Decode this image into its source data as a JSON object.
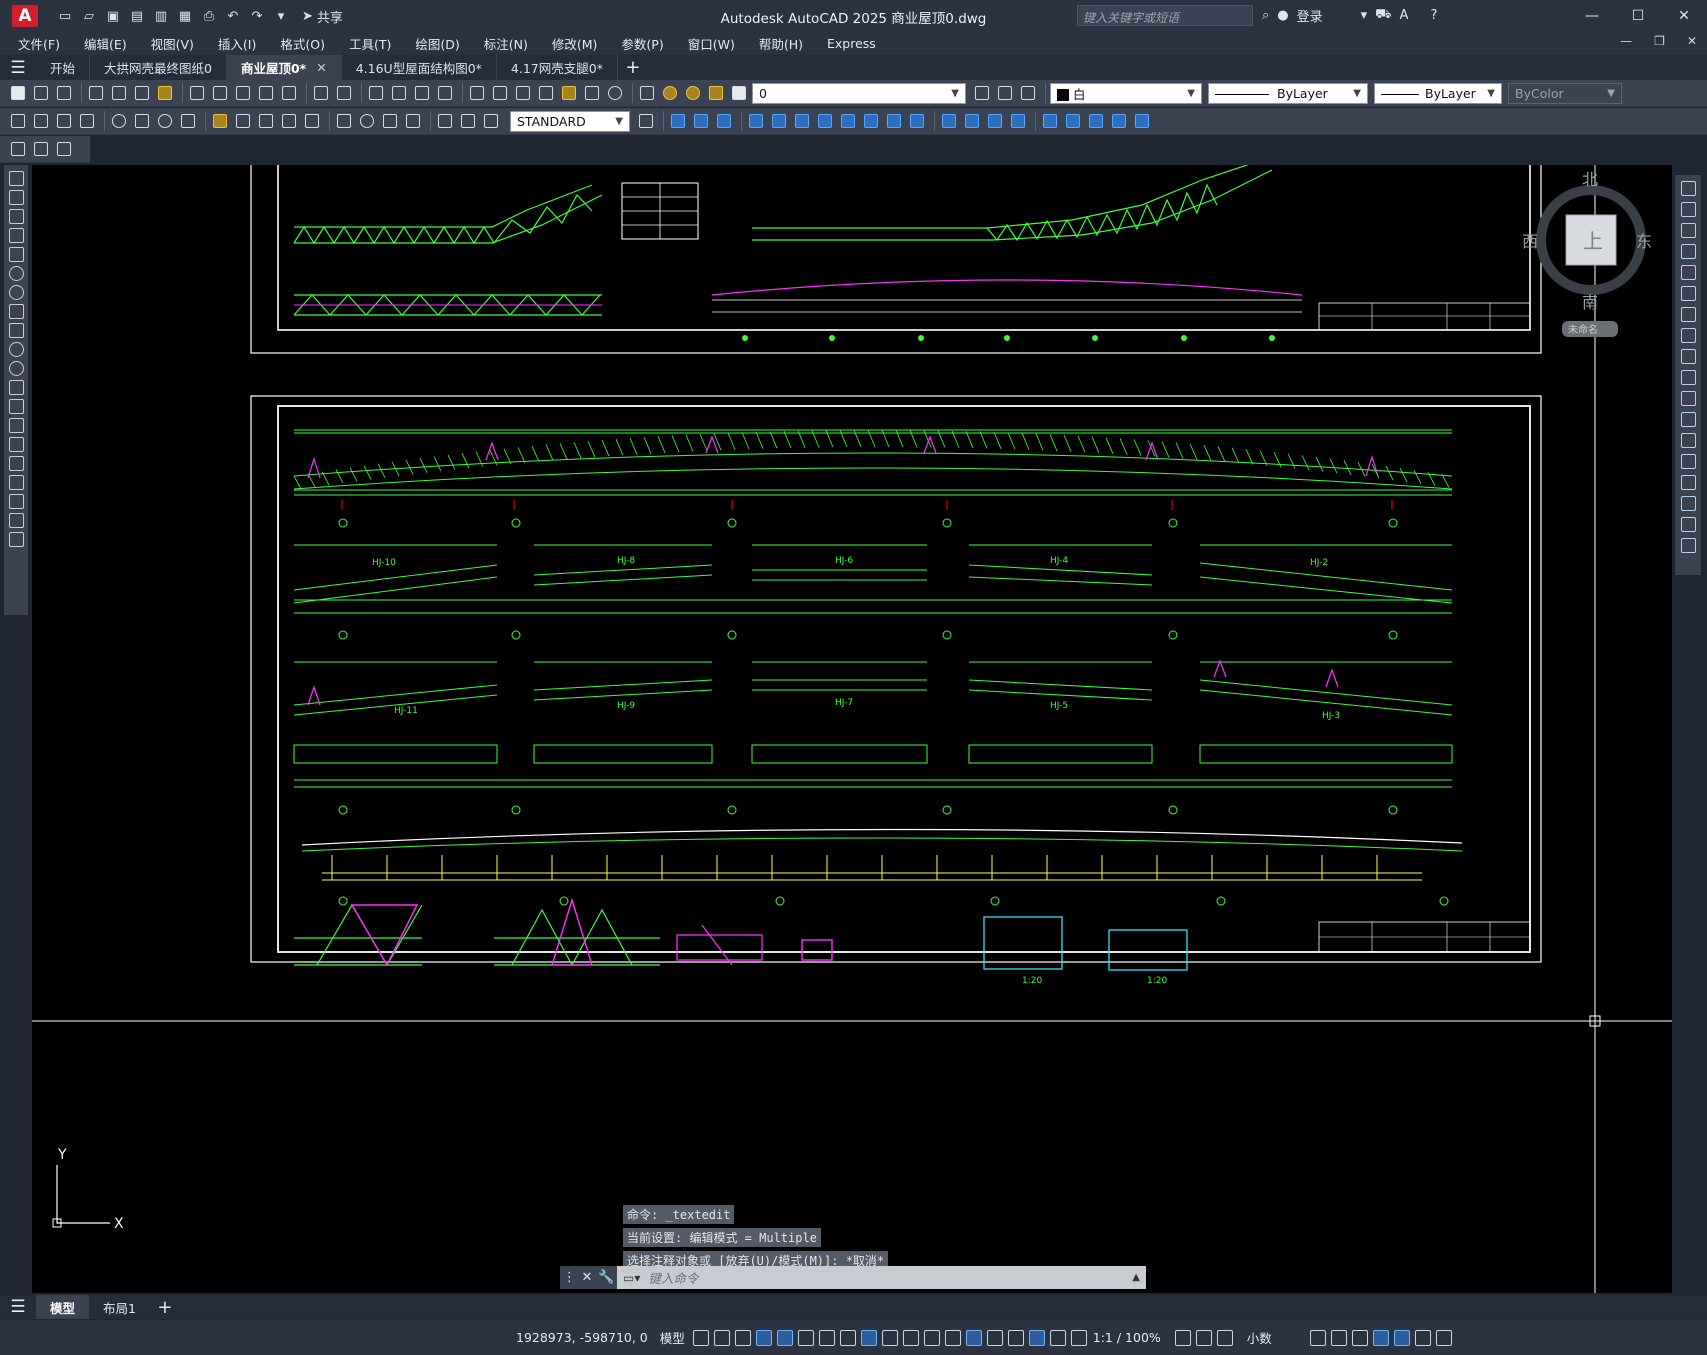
{
  "titlebar": {
    "logo": "A",
    "share_label": "共享",
    "app_title": "Autodesk AutoCAD 2025    商业屋顶0.dwg",
    "search_placeholder": "键入关键字或短语",
    "login_label": "登录"
  },
  "menubar": {
    "items": [
      "文件(F)",
      "编辑(E)",
      "视图(V)",
      "插入(I)",
      "格式(O)",
      "工具(T)",
      "绘图(D)",
      "标注(N)",
      "修改(M)",
      "参数(P)",
      "窗口(W)",
      "帮助(H)",
      "Express"
    ]
  },
  "tabs": [
    {
      "label": "开始"
    },
    {
      "label": "大拱网壳最终图纸0"
    },
    {
      "label": "商业屋顶0*",
      "active": true
    },
    {
      "label": "4.16U型屋面结构图0*"
    },
    {
      "label": "4.17网壳支腿0*"
    }
  ],
  "toolbar": {
    "layer_value": "0",
    "color_value": "白",
    "linetype_value": "ByLayer",
    "lineweight_value": "ByLayer",
    "plotstyle_value": "ByColor",
    "textstyle_value": "STANDARD"
  },
  "viewcube": {
    "north": "北",
    "south": "南",
    "east": "东",
    "west": "西",
    "top": "上",
    "ucs": "未命名"
  },
  "drawing": {
    "labels": [
      "HJ-10",
      "HJ-8",
      "HJ-6",
      "HJ-4",
      "HJ-2",
      "HJ-11",
      "HJ-9",
      "HJ-7",
      "HJ-5",
      "HJ-3"
    ],
    "scale_a": "1:20",
    "scale_b": "1:20"
  },
  "command": {
    "line1": "命令: _textedit",
    "line2": "当前设置: 编辑模式 = Multiple",
    "line3": "选择注释对象或 [放弃(U)/模式(M)]: *取消*",
    "placeholder": "键入命令"
  },
  "layouts": [
    {
      "label": "模型",
      "active": true
    },
    {
      "label": "布局1"
    }
  ],
  "status": {
    "coords": "1928973, -598710, 0",
    "model": "模型",
    "scale": "1:1 / 100%",
    "units": "小数"
  },
  "ucs": {
    "x": "X",
    "y": "Y"
  }
}
